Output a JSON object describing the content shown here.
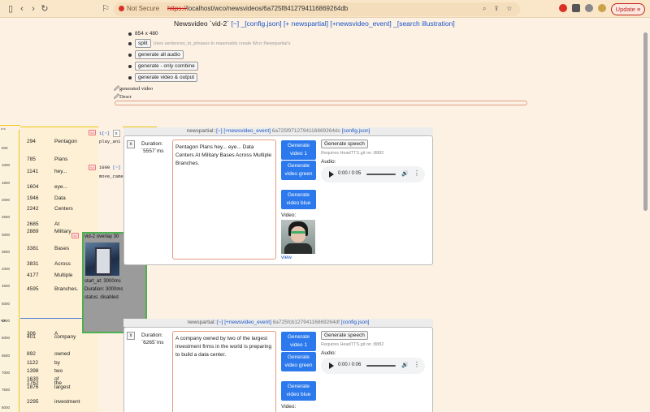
{
  "browser": {
    "not_secure": "Not Secure",
    "url_scheme": "https://",
    "url_rest": "localhost/wco/newsvideos/6a725f8412794116869264db",
    "update_label": "Update"
  },
  "page": {
    "title": "Newsvideo `vid-2`",
    "links": [
      "[~]",
      "_[config.json]",
      "[+ newspartial]",
      "[+newsvideo_event]",
      "_[search illustration]"
    ],
    "resolution": "854 x 480",
    "split_label": "split",
    "split_hint": "Uses sentences_to_phrases to reasonably create Wco::Newspartial's",
    "gen_audio": "generate all audio",
    "gen_combine": "generate - only combine",
    "gen_video_output": "generate video & output",
    "generated_video": "generated video",
    "descr": "Descr"
  },
  "timeline": {
    "ruler_ticks": [
      "500",
      "1000",
      "1500",
      "2000",
      "2500",
      "3000",
      "3500",
      "4000",
      "4500",
      "5000",
      "5500",
      "6000",
      "6500",
      "7000",
      "7500",
      "8000"
    ],
    "words": [
      {
        "t": "294",
        "w": "Pentagon"
      },
      {
        "t": "785",
        "w": "Plans"
      },
      {
        "t": "1141",
        "w": "hey..."
      },
      {
        "t": "1604",
        "w": "eye..."
      },
      {
        "t": "1946",
        "w": "Data"
      },
      {
        "t": "2242",
        "w": "Centers"
      },
      {
        "t": "2685",
        "w": "At"
      },
      {
        "t": "2889",
        "w": "Military"
      },
      {
        "t": "3381",
        "w": "Bases"
      },
      {
        "t": "3831",
        "w": "Across"
      },
      {
        "t": "4177",
        "w": "Multiple"
      },
      {
        "t": "4595",
        "w": "Branches."
      },
      {
        "t": "306",
        "w": "A"
      },
      {
        "t": "401",
        "w": "company"
      },
      {
        "t": "892",
        "w": "owned"
      },
      {
        "t": "1122",
        "w": "by"
      },
      {
        "t": "1398",
        "w": "two"
      },
      {
        "t": "1630",
        "w": "of"
      },
      {
        "t": "1762",
        "w": "the"
      },
      {
        "t": "1876",
        "w": "largest"
      },
      {
        "t": "2295",
        "w": "investment"
      }
    ],
    "event1_name": "play_ani",
    "event1_links": "1[~]",
    "event2_time": "1000",
    "event2_name": "move_came",
    "overlay_title": "vid-2 overlay 30",
    "overlay_start": "start_at: 3000ms",
    "overlay_duration": "Duration: 3000ms",
    "overlay_status": "status: disabled"
  },
  "partials": [
    {
      "label": "newspartial::",
      "link1": "[~]",
      "link2": "[+newsvideo_event]",
      "id": "6a725f9712794116869264dc",
      "link3": "[config.json]",
      "duration_label": "Duration:",
      "duration": "`5557`ms",
      "text": "Pentagon Plans hey... eye... Data Centers At Military Bases Across Multiple Branches.",
      "btn1": "Generate video 1",
      "btn2": "Generate video green",
      "btn3": "Generate video blue",
      "speech": "Generate speech",
      "req": "Requires HeadTTS.git on :8882",
      "audio_label": "Audio:",
      "audio_time": "0:00 / 0:05",
      "video_label": "Video:",
      "view": "view"
    },
    {
      "label": "newspartial::",
      "link1": "[~]",
      "link2": "[+newsvideo_event]",
      "id": "6a725fcb12794116869264df",
      "link3": "[config.json]",
      "duration_label": "Duration:",
      "duration": "`6265`ms",
      "text": "A company owned by two of the largest investment firms in the world is preparing to build a data center.",
      "btn1": "Generate video 1",
      "btn2": "Generate video green",
      "btn3": "Generate video blue",
      "speech": "Generate speech",
      "req": "Requires HeadTTS.git on :8882",
      "audio_label": "Audio:",
      "audio_time": "0:00 / 0:06",
      "video_label": "Video:"
    }
  ],
  "colors": {
    "page_bg": "#fdf1e4",
    "accent_blue": "#2b79ec",
    "overlay_border": "#4caf50",
    "ruler_line": "#f1c40f"
  }
}
